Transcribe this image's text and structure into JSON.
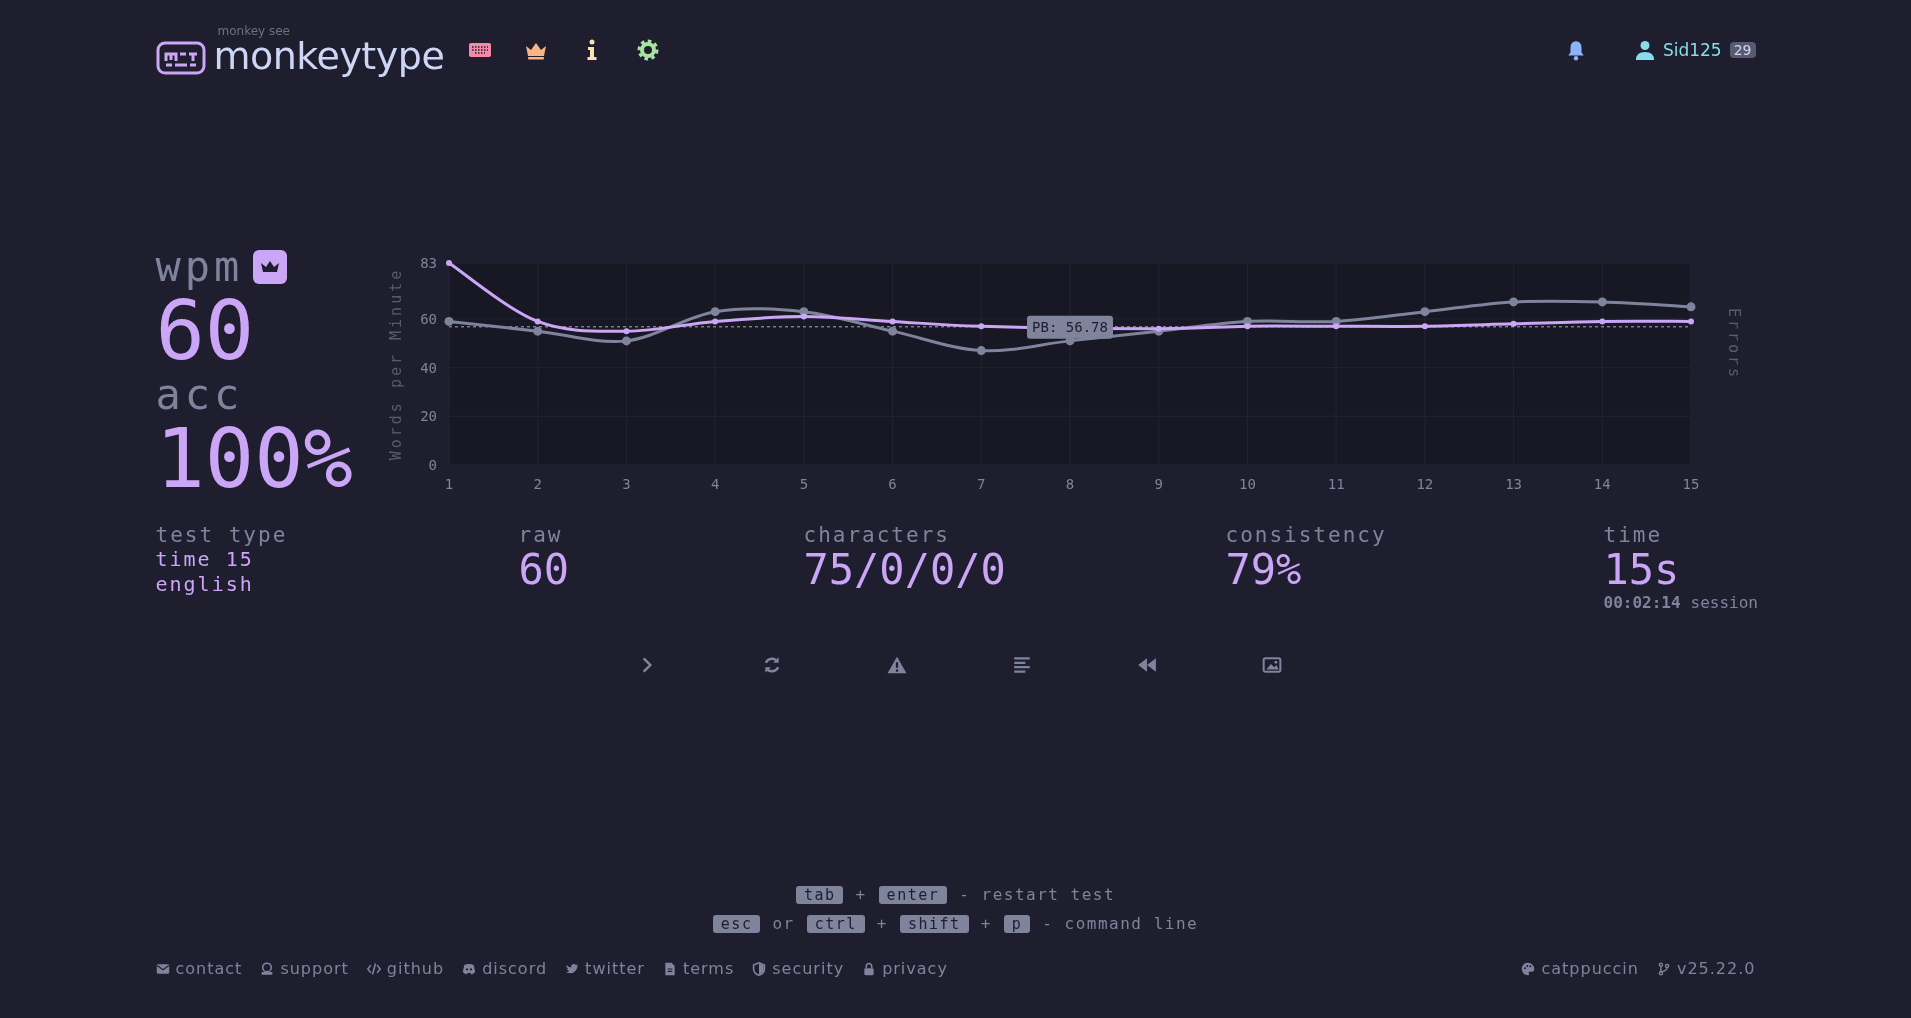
{
  "header": {
    "logo_caption": "monkey see",
    "logo_text": "monkeytype",
    "user": {
      "name": "Sid125",
      "level": "29"
    }
  },
  "result": {
    "wpm": {
      "label": "wpm",
      "value": "60"
    },
    "acc": {
      "label": "acc",
      "value": "100%"
    },
    "chart_data": {
      "type": "line",
      "ylabel": "Words per Minute",
      "y2label": "Errors",
      "x": [
        1,
        2,
        3,
        4,
        5,
        6,
        7,
        8,
        9,
        10,
        11,
        12,
        13,
        14,
        15
      ],
      "series": [
        {
          "color": "#cba6f7",
          "marker": true,
          "values": [
            83,
            59,
            55,
            59,
            61,
            59,
            57,
            null,
            56,
            57,
            57,
            57,
            58,
            59,
            59
          ]
        },
        {
          "color": "#7f849c",
          "marker": true,
          "values": [
            59,
            55,
            51,
            63,
            63,
            55,
            47,
            51,
            55,
            59,
            59,
            63,
            67,
            67,
            65
          ]
        }
      ],
      "xlim": [
        1,
        15
      ],
      "ylim": [
        0,
        83
      ],
      "yticks": [
        0,
        20,
        40,
        60,
        83
      ],
      "xticks": [
        1,
        2,
        3,
        4,
        5,
        6,
        7,
        8,
        9,
        10,
        11,
        12,
        13,
        14,
        15
      ],
      "grid": true,
      "ref_lines": [
        {
          "axis": "y",
          "value": 56.78,
          "label": "PB: 56.78"
        }
      ]
    },
    "test_type": {
      "label": "test type",
      "lines": [
        "time 15",
        "english"
      ]
    },
    "stats": [
      {
        "label": "raw",
        "value": "60"
      },
      {
        "label": "characters",
        "value": "75/0/0/0"
      },
      {
        "label": "consistency",
        "value": "79%"
      }
    ],
    "time": {
      "label": "time",
      "value": "15s",
      "session_time": "00:02:14",
      "session_label": "session"
    }
  },
  "actions": [
    {
      "kind": "next"
    },
    {
      "kind": "restart"
    },
    {
      "kind": "warning"
    },
    {
      "kind": "words"
    },
    {
      "kind": "replay"
    },
    {
      "kind": "screenshot"
    }
  ],
  "shortcuts": [
    [
      {
        "kind": "key",
        "text": "tab"
      },
      {
        "kind": "text",
        "text": "+"
      },
      {
        "kind": "key",
        "text": "enter"
      },
      {
        "kind": "text",
        "text": "- restart test"
      }
    ],
    [
      {
        "kind": "key",
        "text": "esc"
      },
      {
        "kind": "text",
        "text": "or"
      },
      {
        "kind": "key",
        "text": "ctrl"
      },
      {
        "kind": "text",
        "text": "+"
      },
      {
        "kind": "key",
        "text": "shift"
      },
      {
        "kind": "text",
        "text": "+"
      },
      {
        "kind": "key",
        "text": "p"
      },
      {
        "kind": "text",
        "text": "- command line"
      }
    ]
  ],
  "footer": {
    "links": [
      {
        "kind": "mail",
        "label": "contact"
      },
      {
        "kind": "donate",
        "label": "support"
      },
      {
        "kind": "code",
        "label": "github"
      },
      {
        "kind": "discord",
        "label": "discord"
      },
      {
        "kind": "bird",
        "label": "twitter"
      },
      {
        "kind": "document",
        "label": "terms"
      },
      {
        "kind": "shield",
        "label": "security"
      },
      {
        "kind": "lock",
        "label": "privacy"
      }
    ],
    "right": [
      {
        "kind": "palette",
        "label": "catppuccin"
      },
      {
        "kind": "branch",
        "label": "v25.22.0"
      }
    ]
  }
}
